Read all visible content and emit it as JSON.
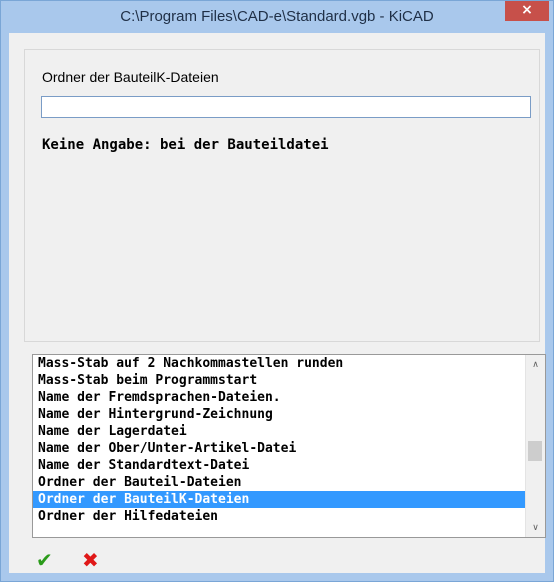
{
  "window": {
    "title": "C:\\Program Files\\CAD-e\\Standard.vgb - KiCAD",
    "close_icon": "×"
  },
  "editor": {
    "field_label": "Ordner der BauteilK-Dateien",
    "input_value": "",
    "info_text": "Keine Angabe: bei der Bauteildatei"
  },
  "list": {
    "items": [
      "Mass-Stab auf 2 Nachkommastellen runden",
      "Mass-Stab beim Programmstart",
      "Name der Fremdsprachen-Dateien.",
      "Name der Hintergrund-Zeichnung",
      "Name der Lagerdatei",
      "Name der Ober/Unter-Artikel-Datei",
      "Name der Standardtext-Datei",
      "Ordner der Bauteil-Dateien",
      "Ordner der BauteilK-Dateien",
      "Ordner der Hilfedateien"
    ],
    "selected_index": 8,
    "scroll_up_icon": "∧",
    "scroll_down_icon": "∨"
  },
  "actions": {
    "ok_icon": "✔",
    "cancel_icon": "✖"
  },
  "colors": {
    "selection": "#3399ff",
    "titlebar": "#a9c8ec",
    "close_button": "#c7504a",
    "ok": "#2b9b1a",
    "cancel": "#e01818"
  }
}
